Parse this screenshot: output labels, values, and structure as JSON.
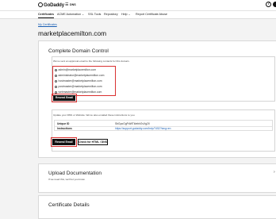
{
  "header": {
    "brand": "GoDaddy",
    "menu_label": "DNS",
    "help_glyph": "?",
    "icons": [
      "godaddy-logo-icon",
      "menu-icon",
      "help-icon",
      "account-icon"
    ]
  },
  "subnav": {
    "tabs": [
      {
        "label": "Certificates",
        "active": true
      },
      {
        "label": "ACME Automation ⌄",
        "active": false
      },
      {
        "label": "SSL Tools",
        "active": false
      },
      {
        "label": "Repository",
        "active": false
      },
      {
        "label": "Help ⌄",
        "active": false
      },
      {
        "label": "Report Certificate Abuse",
        "active": false
      }
    ]
  },
  "breadcrumb": "My Certificates",
  "page_title": "marketplacemilton.com",
  "domain_control": {
    "title": "Complete Domain Control",
    "instructions": "We've sent an approval email to the following contacts for this domain.",
    "emails": [
      "admin@marketplacemilton.com",
      "administrator@marketplacemilton.com",
      "hostmaster@marketplacemilton.com",
      "postmaster@marketplacemilton.com",
      "webmaster@marketplacemilton.com"
    ],
    "resend_label": "Resend Email",
    "dns_instructions": "Update your DNS or Website. We've also emailed these instructions to you.",
    "unique_id_label": "Unique ID",
    "unique_id_value": "SbGpoGgPdWTkIebhGvXg2ll",
    "instructions_label": "Instructions",
    "instructions_link": "https://support.godaddy.com/help/7452?lang=en",
    "resend2_label": "Resend Email",
    "check_label": "Check for HTML / DNS"
  },
  "upload": {
    "title": "Upload Documentation",
    "subtitle": "If we need this, we'll let you know."
  },
  "details": {
    "title": "Certificate Details"
  },
  "colors": {
    "highlight": "#d93131",
    "link": "#1a5fb4",
    "button": "#111111"
  }
}
